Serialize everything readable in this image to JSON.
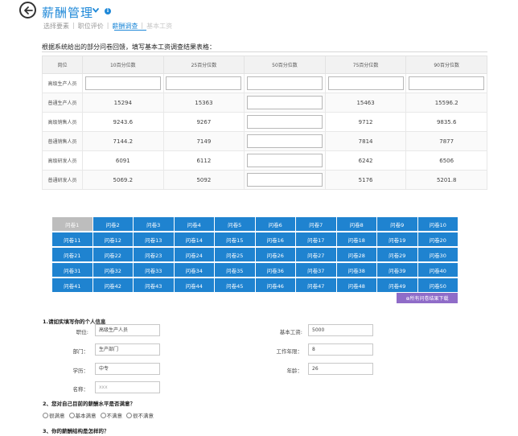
{
  "header": {
    "title": "薪酬管理",
    "info_glyph": "i",
    "tabs": [
      {
        "label": "选择要素",
        "state": "normal"
      },
      {
        "label": "职位评价",
        "state": "normal"
      },
      {
        "label": "薪酬调查",
        "state": "active"
      },
      {
        "label": "基本工资",
        "state": "disabled"
      }
    ],
    "tab_separator": "|"
  },
  "intro_text": "根据系统给出的部分问卷回馈，填写基本工资调查结果表格：",
  "table": {
    "headers": [
      "岗位",
      "10百分位数",
      "25百分位数",
      "50百分位数",
      "75百分位数",
      "90百分位数"
    ],
    "rows": [
      {
        "position": "高级生产人员",
        "cells": [
          null,
          null,
          null,
          null,
          null
        ]
      },
      {
        "position": "普通生产人员",
        "cells": [
          "15294",
          "15363",
          null,
          "15463",
          "15596.2"
        ]
      },
      {
        "position": "高级销售人员",
        "cells": [
          "9243.6",
          "9267",
          null,
          "9712",
          "9835.6"
        ]
      },
      {
        "position": "普通销售人员",
        "cells": [
          "7144.2",
          "7149",
          null,
          "7814",
          "7877"
        ]
      },
      {
        "position": "高级研发人员",
        "cells": [
          "6091",
          "6112",
          null,
          "6242",
          "6506"
        ]
      },
      {
        "position": "普通研发人员",
        "cells": [
          "5069.2",
          "5092",
          null,
          "5176",
          "5201.8"
        ]
      }
    ]
  },
  "questionnaires": {
    "items": [
      "问卷1",
      "问卷2",
      "问卷3",
      "问卷4",
      "问卷5",
      "问卷6",
      "问卷7",
      "问卷8",
      "问卷9",
      "问卷10",
      "问卷11",
      "问卷12",
      "问卷13",
      "问卷14",
      "问卷15",
      "问卷16",
      "问卷17",
      "问卷18",
      "问卷19",
      "问卷20",
      "问卷21",
      "问卷22",
      "问卷23",
      "问卷24",
      "问卷25",
      "问卷26",
      "问卷27",
      "问卷28",
      "问卷29",
      "问卷30",
      "问卷31",
      "问卷32",
      "问卷33",
      "问卷34",
      "问卷35",
      "问卷36",
      "问卷37",
      "问卷38",
      "问卷39",
      "问卷40",
      "问卷41",
      "问卷42",
      "问卷43",
      "问卷44",
      "问卷45",
      "问卷46",
      "问卷47",
      "问卷48",
      "问卷49",
      "问卷50"
    ],
    "selected": "问卷1",
    "download_label": "⊕所有问卷结果下载"
  },
  "form": {
    "section1": "1.请如实填写你的个人信息",
    "position_label": "职位:",
    "position_value": "高级生产人员",
    "dept_label": "部门：",
    "dept_value": "生产部门",
    "edu_label": "学历：",
    "edu_value": "中专",
    "name_label": "名称：",
    "name_value": "xxx",
    "salary_label": "基本工资:",
    "salary_value": "5000",
    "years_label": "工作年限：",
    "years_value": "8",
    "age_label": "年龄：",
    "age_value": "26",
    "section2": "2、您对自己目前的薪酬水平是否满意？",
    "options": [
      "很满意",
      "基本满意",
      "不满意",
      "很不满意"
    ],
    "section3": "3、你的薪酬结构是怎样的？"
  },
  "colors": {
    "accent": "#1e88d8",
    "grid_button": "#1f83d0",
    "download_button": "#8f6cc8"
  }
}
